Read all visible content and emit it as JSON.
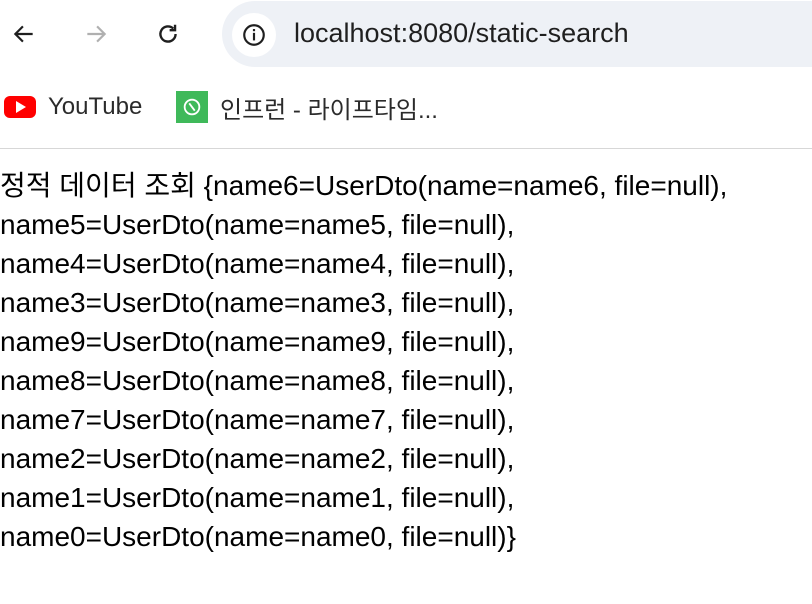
{
  "browser": {
    "url": "localhost:8080/static-search",
    "nav_icons": [
      "back-arrow-icon",
      "forward-arrow-icon",
      "reload-icon",
      "info-icon"
    ]
  },
  "bookmarks": [
    {
      "label": "YouTube",
      "icon": "youtube-icon"
    },
    {
      "label": "인프런 - 라이프타임...",
      "icon": "inflearn-icon"
    }
  ],
  "page": {
    "lines": [
      "정적 데이터 조회 {name6=UserDto(name=name6, file=null),",
      "name5=UserDto(name=name5, file=null),",
      "name4=UserDto(name=name4, file=null),",
      "name3=UserDto(name=name3, file=null),",
      "name9=UserDto(name=name9, file=null),",
      "name8=UserDto(name=name8, file=null),",
      "name7=UserDto(name=name7, file=null),",
      "name2=UserDto(name=name2, file=null),",
      "name1=UserDto(name=name1, file=null),",
      "name0=UserDto(name=name0, file=null)}"
    ]
  },
  "colors": {
    "omnibox_bg": "#eef1f6",
    "youtube_red": "#ff0000",
    "inflearn_green": "#3fb95a",
    "forward_disabled": "#b0b0b0"
  }
}
